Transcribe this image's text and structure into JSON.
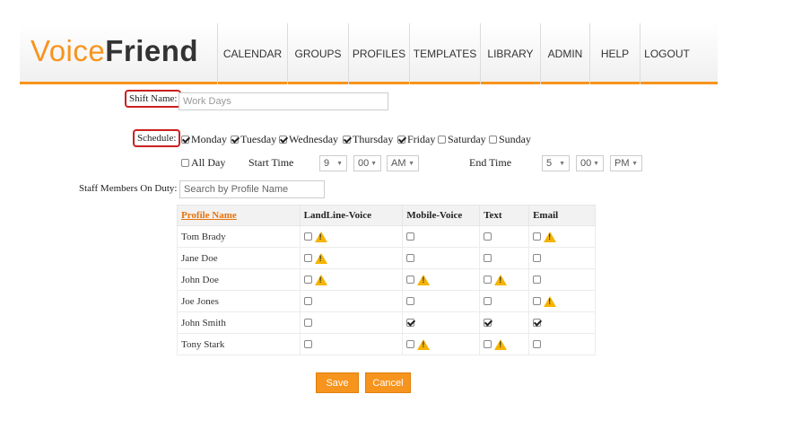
{
  "logo": {
    "voice": "Voice",
    "friend": "Friend"
  },
  "nav": [
    "CALENDAR",
    "GROUPS",
    "PROFILES",
    "TEMPLATES",
    "LIBRARY",
    "ADMIN",
    "HELP",
    "LOGOUT"
  ],
  "shift": {
    "label": "Shift Name:",
    "value": "Work Days"
  },
  "schedule": {
    "label": "Schedule:",
    "days": [
      {
        "name": "Monday",
        "checked": true
      },
      {
        "name": "Tuesday",
        "checked": true
      },
      {
        "name": "Wednesday",
        "checked": true
      },
      {
        "name": "Thursday",
        "checked": true
      },
      {
        "name": "Friday",
        "checked": true
      },
      {
        "name": "Saturday",
        "checked": false
      },
      {
        "name": "Sunday",
        "checked": false
      }
    ],
    "all_day": {
      "label": "All Day",
      "checked": false
    },
    "start": {
      "label": "Start Time",
      "hour": "9",
      "minute": "00",
      "ampm": "AM"
    },
    "end": {
      "label": "End Time",
      "hour": "5",
      "minute": "00",
      "ampm": "PM"
    }
  },
  "staff": {
    "label": "Staff Members On Duty:",
    "placeholder": "Search by Profile Name"
  },
  "table": {
    "headers": [
      "Profile Name",
      "LandLine-Voice",
      "Mobile-Voice",
      "Text",
      "Email"
    ],
    "rows": [
      {
        "name": "Tom Brady",
        "cells": [
          [
            false,
            true
          ],
          [
            false,
            false
          ],
          [
            false,
            false
          ],
          [
            false,
            true
          ]
        ]
      },
      {
        "name": "Jane Doe",
        "cells": [
          [
            false,
            true
          ],
          [
            false,
            false
          ],
          [
            false,
            false
          ],
          [
            false,
            false
          ]
        ]
      },
      {
        "name": "John Doe",
        "cells": [
          [
            false,
            true
          ],
          [
            false,
            true
          ],
          [
            false,
            true
          ],
          [
            false,
            false
          ]
        ]
      },
      {
        "name": "Joe Jones",
        "cells": [
          [
            false,
            false
          ],
          [
            false,
            false
          ],
          [
            false,
            false
          ],
          [
            false,
            true
          ]
        ]
      },
      {
        "name": "John Smith",
        "cells": [
          [
            false,
            false
          ],
          [
            true,
            false
          ],
          [
            true,
            false
          ],
          [
            true,
            false
          ]
        ]
      },
      {
        "name": "Tony Stark",
        "cells": [
          [
            false,
            false
          ],
          [
            false,
            true
          ],
          [
            false,
            true
          ],
          [
            false,
            false
          ]
        ]
      }
    ]
  },
  "buttons": {
    "save": "Save",
    "cancel": "Cancel"
  },
  "colors": {
    "accent": "#f7941d",
    "highlight_box": "#cc1f1f",
    "warning": "#f5b400"
  }
}
